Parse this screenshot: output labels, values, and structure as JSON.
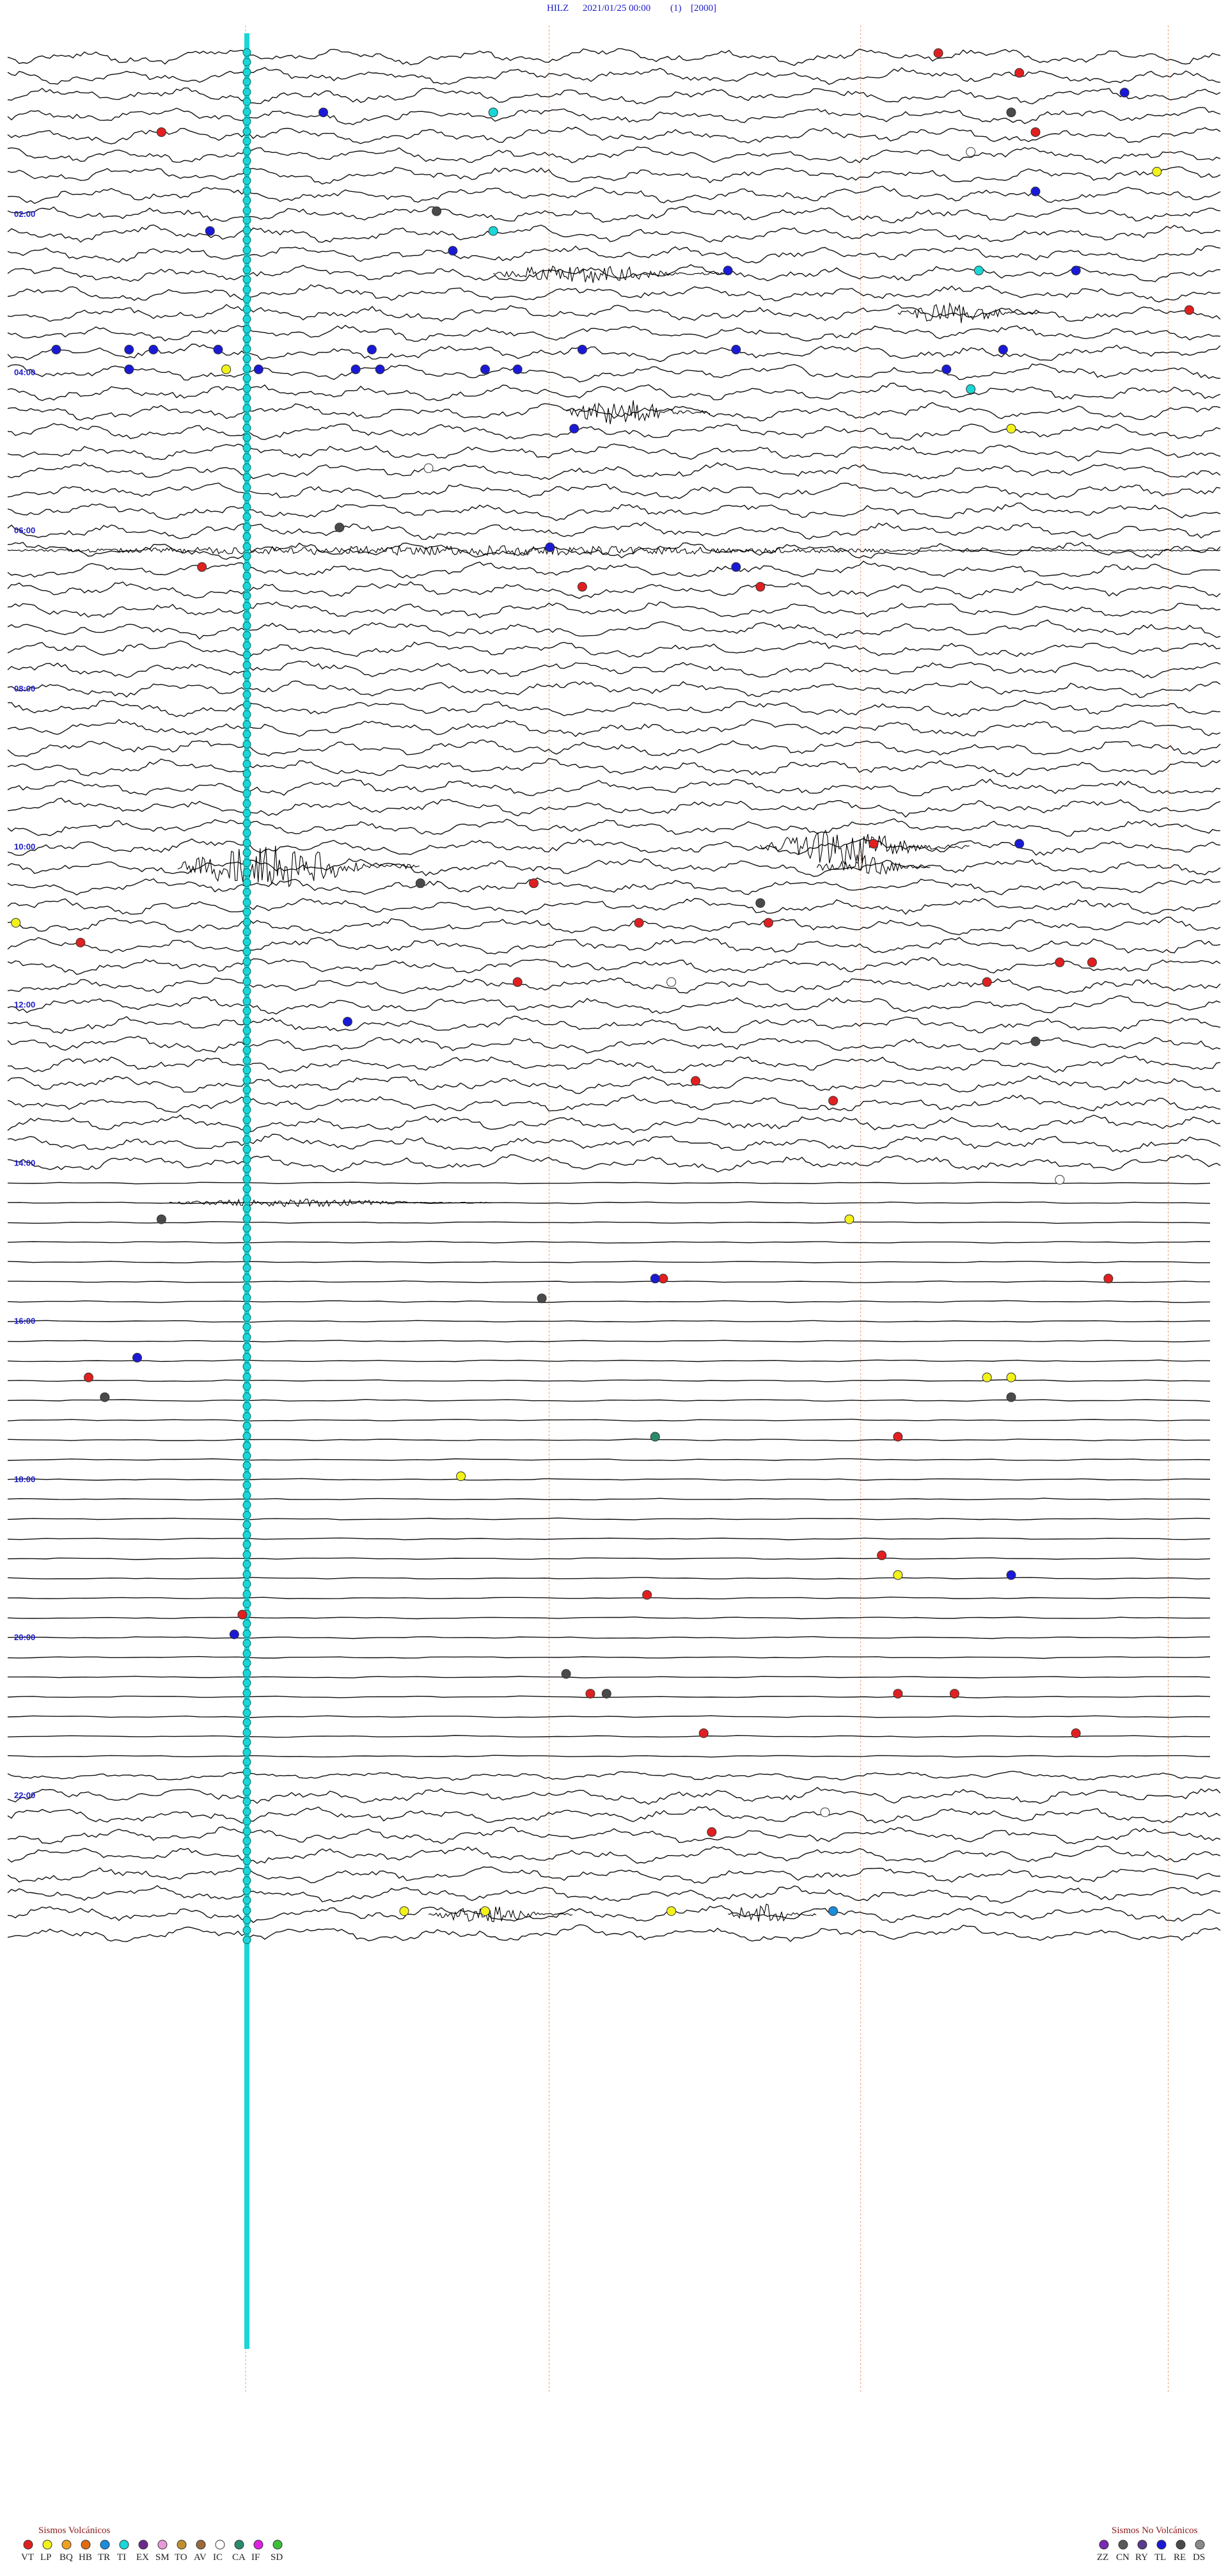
{
  "header": {
    "station": "HILZ",
    "datetime": "2021/01/25 00:00",
    "channel": "(1)",
    "scale": "[2000]"
  },
  "chart_data": {
    "type": "helicorder",
    "traces_total": 96,
    "minutes_per_trace": 15,
    "hour_labels": [
      "02:00",
      "04:00",
      "06:00",
      "08:00",
      "10:00",
      "12:00",
      "14:00",
      "16:00",
      "18:00",
      "20:00",
      "22:00"
    ],
    "hour_label_rows": [
      8,
      16,
      24,
      32,
      40,
      48,
      56,
      64,
      72,
      80,
      88
    ],
    "quiet_rows": [
      57,
      86
    ],
    "events": [
      {
        "row": 0,
        "minute": 11.5,
        "type": "VT"
      },
      {
        "row": 1,
        "minute": 12.5,
        "type": "VT"
      },
      {
        "row": 2,
        "minute": 13.8,
        "type": "TL"
      },
      {
        "row": 3,
        "minute": 3.9,
        "type": "TL"
      },
      {
        "row": 3,
        "minute": 6.0,
        "type": "TI"
      },
      {
        "row": 3,
        "minute": 12.4,
        "type": "RE"
      },
      {
        "row": 4,
        "minute": 1.9,
        "type": "VT"
      },
      {
        "row": 4,
        "minute": 12.7,
        "type": "VT"
      },
      {
        "row": 5,
        "minute": 11.9,
        "type": "IC"
      },
      {
        "row": 6,
        "minute": 14.2,
        "type": "LP"
      },
      {
        "row": 7,
        "minute": 12.7,
        "type": "TL"
      },
      {
        "row": 8,
        "minute": 5.3,
        "type": "RE"
      },
      {
        "row": 9,
        "minute": 2.5,
        "type": "TL"
      },
      {
        "row": 9,
        "minute": 6.0,
        "type": "TI"
      },
      {
        "row": 10,
        "minute": 5.5,
        "type": "TL"
      },
      {
        "row": 11,
        "minute": 12.0,
        "type": "TI"
      },
      {
        "row": 11,
        "minute": 13.2,
        "type": "TL"
      },
      {
        "row": 11,
        "minute": 8.9,
        "type": "TL"
      },
      {
        "row": 13,
        "minute": 14.6,
        "type": "VT"
      },
      {
        "row": 15,
        "minute": 0.6,
        "type": "TL"
      },
      {
        "row": 15,
        "minute": 1.5,
        "type": "TL"
      },
      {
        "row": 15,
        "minute": 1.8,
        "type": "TL"
      },
      {
        "row": 15,
        "minute": 2.6,
        "type": "TL"
      },
      {
        "row": 15,
        "minute": 4.5,
        "type": "TL"
      },
      {
        "row": 15,
        "minute": 7.1,
        "type": "TL"
      },
      {
        "row": 15,
        "minute": 9.0,
        "type": "TL"
      },
      {
        "row": 15,
        "minute": 12.3,
        "type": "TL"
      },
      {
        "row": 16,
        "minute": 1.5,
        "type": "TL"
      },
      {
        "row": 16,
        "minute": 2.7,
        "type": "LP"
      },
      {
        "row": 16,
        "minute": 3.1,
        "type": "TL"
      },
      {
        "row": 16,
        "minute": 4.3,
        "type": "TL"
      },
      {
        "row": 16,
        "minute": 4.6,
        "type": "TL"
      },
      {
        "row": 16,
        "minute": 5.9,
        "type": "TL"
      },
      {
        "row": 16,
        "minute": 6.3,
        "type": "TL"
      },
      {
        "row": 16,
        "minute": 11.6,
        "type": "TL"
      },
      {
        "row": 17,
        "minute": 11.9,
        "type": "TI"
      },
      {
        "row": 19,
        "minute": 12.4,
        "type": "LP"
      },
      {
        "row": 19,
        "minute": 7.0,
        "type": "TL"
      },
      {
        "row": 21,
        "minute": 5.2,
        "type": "IC"
      },
      {
        "row": 24,
        "minute": 4.1,
        "type": "RE"
      },
      {
        "row": 25,
        "minute": 6.7,
        "type": "TL"
      },
      {
        "row": 26,
        "minute": 2.4,
        "type": "VT"
      },
      {
        "row": 26,
        "minute": 9.0,
        "type": "TL"
      },
      {
        "row": 27,
        "minute": 7.1,
        "type": "VT"
      },
      {
        "row": 27,
        "minute": 9.3,
        "type": "VT"
      },
      {
        "row": 40,
        "minute": 10.7,
        "type": "VT"
      },
      {
        "row": 40,
        "minute": 12.5,
        "type": "TL"
      },
      {
        "row": 42,
        "minute": 5.1,
        "type": "RE"
      },
      {
        "row": 42,
        "minute": 6.5,
        "type": "VT"
      },
      {
        "row": 43,
        "minute": 9.3,
        "type": "RE"
      },
      {
        "row": 44,
        "minute": 7.8,
        "type": "VT"
      },
      {
        "row": 44,
        "minute": 9.4,
        "type": "VT"
      },
      {
        "row": 44,
        "minute": 0.1,
        "type": "LP"
      },
      {
        "row": 45,
        "minute": 0.9,
        "type": "VT"
      },
      {
        "row": 46,
        "minute": 13.0,
        "type": "VT"
      },
      {
        "row": 46,
        "minute": 13.4,
        "type": "VT"
      },
      {
        "row": 47,
        "minute": 6.3,
        "type": "VT"
      },
      {
        "row": 47,
        "minute": 8.2,
        "type": "IC"
      },
      {
        "row": 47,
        "minute": 12.1,
        "type": "VT"
      },
      {
        "row": 49,
        "minute": 4.2,
        "type": "TL"
      },
      {
        "row": 50,
        "minute": 12.7,
        "type": "RE"
      },
      {
        "row": 52,
        "minute": 8.5,
        "type": "VT"
      },
      {
        "row": 53,
        "minute": 10.2,
        "type": "VT"
      },
      {
        "row": 57,
        "minute": 13.0,
        "type": "IC"
      },
      {
        "row": 59,
        "minute": 1.9,
        "type": "RE"
      },
      {
        "row": 59,
        "minute": 10.4,
        "type": "LP"
      },
      {
        "row": 62,
        "minute": 8.1,
        "type": "VT"
      },
      {
        "row": 62,
        "minute": 8.0,
        "type": "TL"
      },
      {
        "row": 62,
        "minute": 13.6,
        "type": "VT"
      },
      {
        "row": 63,
        "minute": 6.6,
        "type": "RE"
      },
      {
        "row": 66,
        "minute": 1.6,
        "type": "TL"
      },
      {
        "row": 67,
        "minute": 1.0,
        "type": "VT"
      },
      {
        "row": 67,
        "minute": 12.1,
        "type": "LP"
      },
      {
        "row": 67,
        "minute": 12.4,
        "type": "LP"
      },
      {
        "row": 68,
        "minute": 1.2,
        "type": "RE"
      },
      {
        "row": 68,
        "minute": 12.4,
        "type": "RE"
      },
      {
        "row": 70,
        "minute": 8.0,
        "type": "CA"
      },
      {
        "row": 70,
        "minute": 11.0,
        "type": "VT"
      },
      {
        "row": 72,
        "minute": 5.6,
        "type": "LP"
      },
      {
        "row": 76,
        "minute": 10.8,
        "type": "VT"
      },
      {
        "row": 77,
        "minute": 11.0,
        "type": "LP"
      },
      {
        "row": 77,
        "minute": 12.4,
        "type": "TL"
      },
      {
        "row": 78,
        "minute": 7.9,
        "type": "VT"
      },
      {
        "row": 79,
        "minute": 2.9,
        "type": "VT"
      },
      {
        "row": 80,
        "minute": 2.8,
        "type": "TL"
      },
      {
        "row": 82,
        "minute": 6.9,
        "type": "RE"
      },
      {
        "row": 83,
        "minute": 7.2,
        "type": "VT"
      },
      {
        "row": 83,
        "minute": 7.4,
        "type": "RE"
      },
      {
        "row": 83,
        "minute": 11.0,
        "type": "VT"
      },
      {
        "row": 83,
        "minute": 11.7,
        "type": "VT"
      },
      {
        "row": 85,
        "minute": 8.6,
        "type": "VT"
      },
      {
        "row": 85,
        "minute": 13.2,
        "type": "VT"
      },
      {
        "row": 89,
        "minute": 10.1,
        "type": "IC"
      },
      {
        "row": 90,
        "minute": 8.7,
        "type": "VT"
      },
      {
        "row": 94,
        "minute": 4.9,
        "type": "LP"
      },
      {
        "row": 94,
        "minute": 5.9,
        "type": "LP"
      },
      {
        "row": 94,
        "minute": 8.2,
        "type": "LP"
      },
      {
        "row": 94,
        "minute": 10.2,
        "type": "TR"
      }
    ],
    "bursts": [
      {
        "row": 11,
        "start_minute": 6.0,
        "end_minute": 8.9,
        "amp": 1.2
      },
      {
        "row": 13,
        "start_minute": 11.0,
        "end_minute": 12.8,
        "amp": 1.3
      },
      {
        "row": 18,
        "start_minute": 6.9,
        "end_minute": 8.7,
        "amp": 1.6
      },
      {
        "row": 25,
        "start_minute": 0.0,
        "end_minute": 15.0,
        "amp": 0.6
      },
      {
        "row": 40,
        "start_minute": 9.3,
        "end_minute": 11.9,
        "amp": 2.2
      },
      {
        "row": 41,
        "start_minute": 2.1,
        "end_minute": 5.1,
        "amp": 2.6
      },
      {
        "row": 41,
        "start_minute": 10.0,
        "end_minute": 11.4,
        "amp": 1.5
      },
      {
        "row": 58,
        "start_minute": 2.0,
        "end_minute": 6.0,
        "amp": 0.5
      },
      {
        "row": 94,
        "start_minute": 5.2,
        "end_minute": 7.0,
        "amp": 1.0
      },
      {
        "row": 94,
        "start_minute": 8.9,
        "end_minute": 10.0,
        "amp": 1.4
      }
    ]
  },
  "legend": {
    "volcanic_title": "Sismos Volcánicos",
    "non_volcanic_title": "Sismos No Volcánicos",
    "volcanic": [
      {
        "code": "VT",
        "color": "#e02020"
      },
      {
        "code": "LP",
        "color": "#f2f21a"
      },
      {
        "code": "BQ",
        "color": "#f0a020"
      },
      {
        "code": "HB",
        "color": "#e06a10"
      },
      {
        "code": "TR",
        "color": "#1a8cdc"
      },
      {
        "code": "TI",
        "color": "#1ad6d6"
      },
      {
        "code": "EX",
        "color": "#6a2a8c"
      },
      {
        "code": "SM",
        "color": "#e89ad8"
      },
      {
        "code": "TO",
        "color": "#c09030"
      },
      {
        "code": "AV",
        "color": "#9a6a3a"
      },
      {
        "code": "IC",
        "color": "#ffffff"
      },
      {
        "code": "CA",
        "color": "#2a8a6a"
      },
      {
        "code": "IF",
        "color": "#e020e0"
      },
      {
        "code": "SD",
        "color": "#3cc03c"
      }
    ],
    "non_volcanic": [
      {
        "code": "ZZ",
        "color": "#7a2ab0"
      },
      {
        "code": "CN",
        "color": "#5a5a5a"
      },
      {
        "code": "RY",
        "color": "#5a3a8a"
      },
      {
        "code": "TL",
        "color": "#1a1ad6"
      },
      {
        "code": "RE",
        "color": "#4a4a4a"
      },
      {
        "code": "DS",
        "color": "#8a8a8a"
      }
    ]
  },
  "colors": {
    "trace": "#111111",
    "minute_marker": "#e8a070",
    "hour_label": "#1a1acc",
    "ti_column": "#1ad6d6"
  }
}
